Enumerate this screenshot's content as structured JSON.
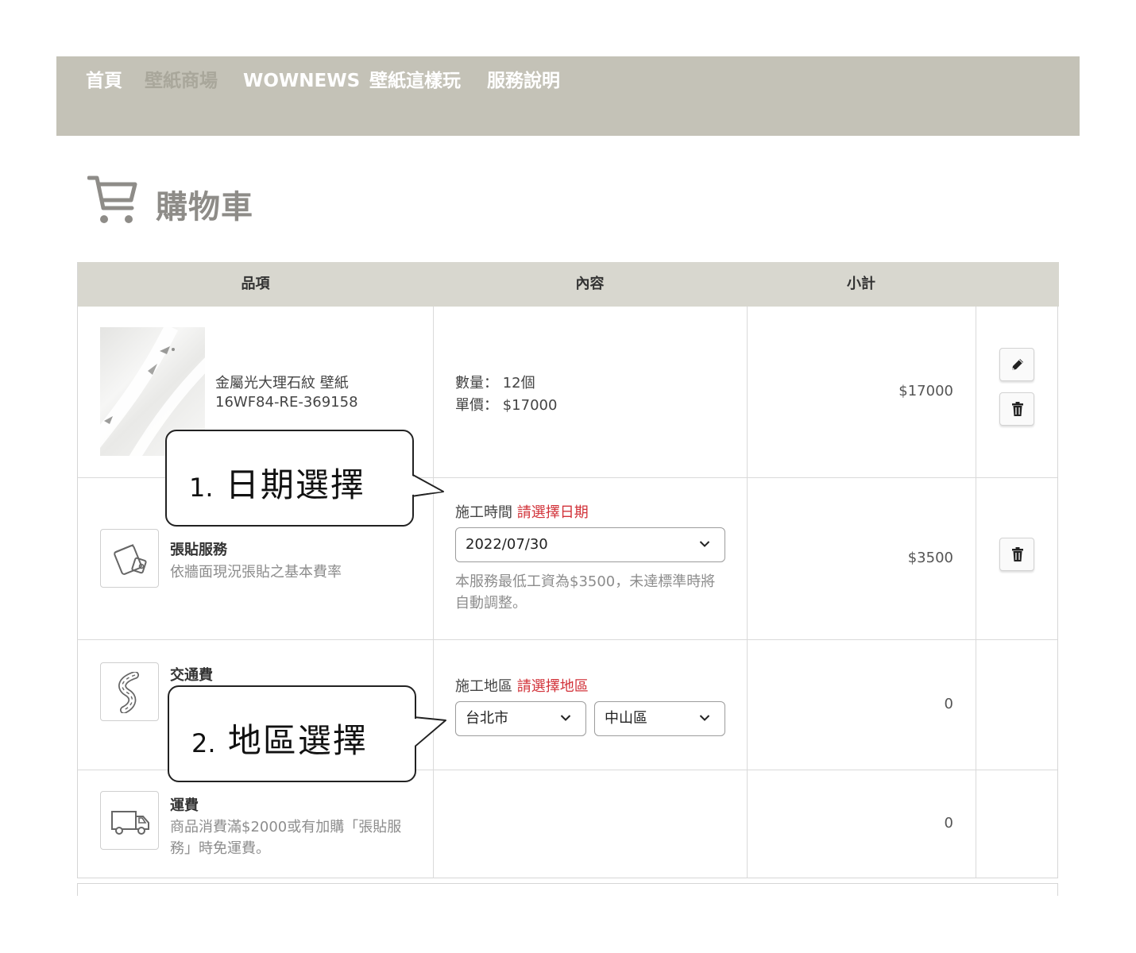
{
  "nav": {
    "items": [
      {
        "label": "首頁"
      },
      {
        "label": "壁紙商場"
      },
      {
        "label": "WOWNEWS"
      },
      {
        "label": "壁紙這樣玩"
      },
      {
        "label": "服務說明"
      }
    ]
  },
  "page": {
    "title": "購物車"
  },
  "table": {
    "headers": {
      "item": "品項",
      "content": "內容",
      "subtotal": "小計"
    },
    "product": {
      "name": "金屬光大理石紋 壁紙",
      "sku": "16WF84-RE-369158",
      "quantity_label": "數量：",
      "quantity": "12個",
      "unit_price_label": "單價：",
      "unit_price": "$17000",
      "subtotal": "$17000"
    },
    "install": {
      "name": "張貼服務",
      "desc": "依牆面現況張貼之基本費率",
      "time_label": "施工時間",
      "time_prompt": "請選擇日期",
      "date_value": "2022/07/30",
      "note_line1": "本服務最低工資為$3500，未達標準時將",
      "note_line2": "自動調整。",
      "subtotal": "$3500"
    },
    "transport": {
      "name": "交通費",
      "area_label": "施工地區",
      "area_prompt": "請選擇地區",
      "city": "台北市",
      "district": "中山區",
      "subtotal": "0"
    },
    "shipping": {
      "name": "運費",
      "desc_line1": "商品消費滿$2000或有加購「張貼服",
      "desc_line2": "務」時免運費。",
      "subtotal": "0"
    }
  },
  "callouts": {
    "date": {
      "num": "1.",
      "text": "日期選擇"
    },
    "area": {
      "num": "2.",
      "text": "地區選擇"
    }
  },
  "colors": {
    "nav_bg": "#c4c2b7",
    "header_bg": "#d8d7cf",
    "prompt_red": "#d2333a"
  }
}
